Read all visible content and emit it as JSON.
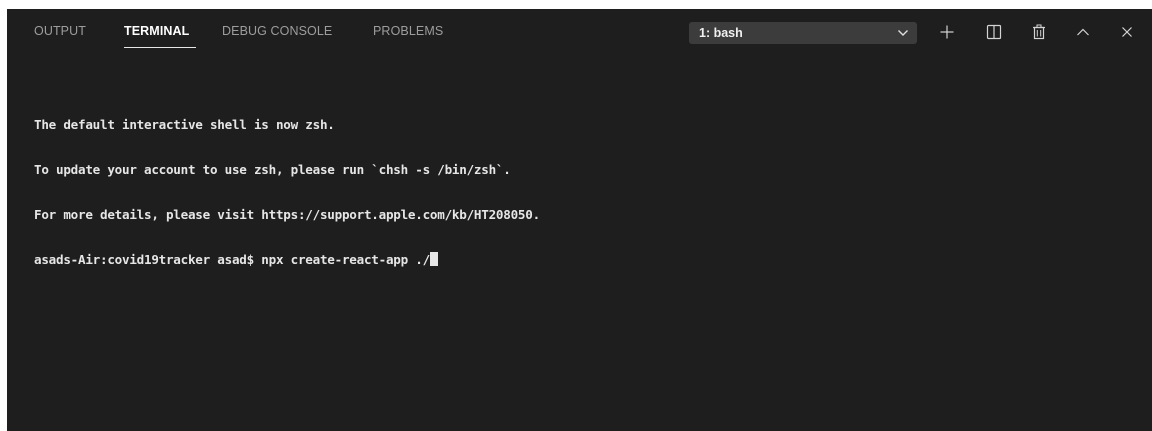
{
  "tabs": [
    {
      "label": "OUTPUT"
    },
    {
      "label": "TERMINAL"
    },
    {
      "label": "DEBUG CONSOLE"
    },
    {
      "label": "PROBLEMS"
    }
  ],
  "active_tab": "TERMINAL",
  "terminal_select": {
    "selected": "1: bash"
  },
  "actions": {
    "new_terminal_icon": "plus-icon",
    "split_icon": "split-icon",
    "kill_icon": "trash-icon",
    "maximize_icon": "chevron-up-icon",
    "close_icon": "close-icon"
  },
  "terminal": {
    "lines": [
      "The default interactive shell is now zsh.",
      "To update your account to use zsh, please run `chsh -s /bin/zsh`.",
      "For more details, please visit https://support.apple.com/kb/HT208050."
    ],
    "prompt": "asads-Air:covid19tracker asad$ ",
    "command": "npx create-react-app ./"
  },
  "colors": {
    "background": "#1e1e1e",
    "text": "#e6e6e6",
    "tab_inactive": "#9d9d9d",
    "tab_active": "#ffffff",
    "dropdown_bg": "#3c3c3c"
  }
}
